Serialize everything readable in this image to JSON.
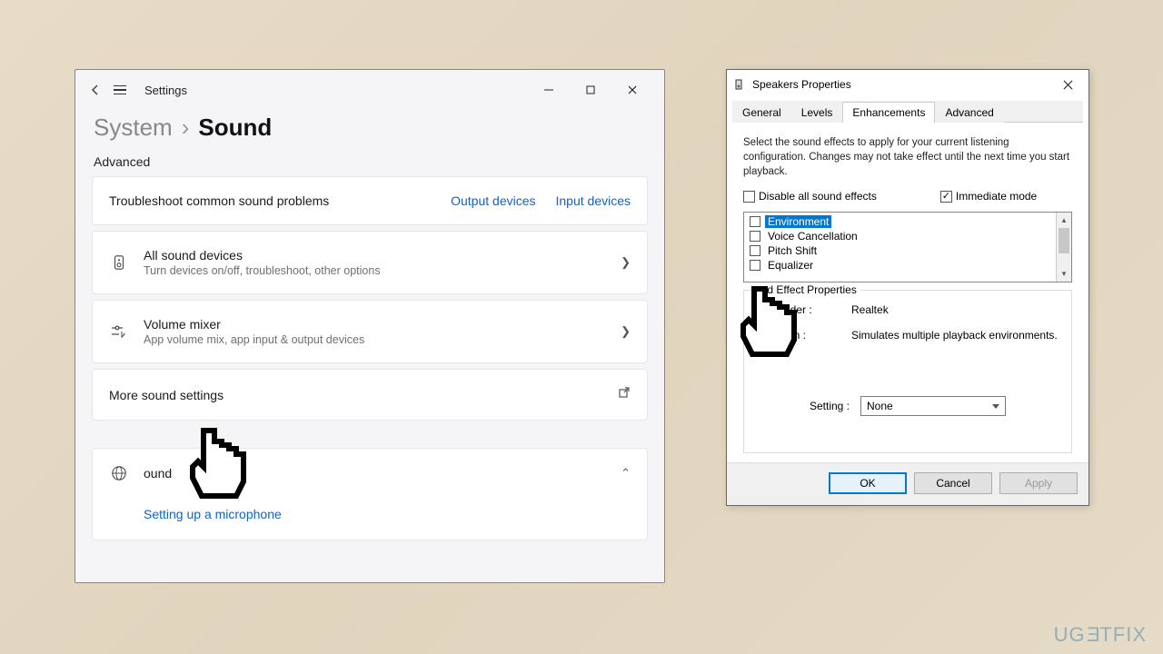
{
  "settings": {
    "title": "Settings",
    "breadcrumb": {
      "parent": "System",
      "sep": "›",
      "current": "Sound"
    },
    "section": "Advanced",
    "troubleshoot": {
      "title": "Troubleshoot common sound problems",
      "output_link": "Output devices",
      "input_link": "Input devices"
    },
    "all_devices": {
      "title": "All sound devices",
      "sub": "Turn devices on/off, troubleshoot, other options"
    },
    "mixer": {
      "title": "Volume mixer",
      "sub": "App volume mix, app input & output devices"
    },
    "more": {
      "title": "More sound settings"
    },
    "help": {
      "title": "ound",
      "link": "Setting up a microphone"
    }
  },
  "dialog": {
    "title": "Speakers Properties",
    "tabs": {
      "general": "General",
      "levels": "Levels",
      "enhancements": "Enhancements",
      "advanced": "Advanced"
    },
    "instruction": "Select the sound effects to apply for your current listening configuration. Changes may not take effect until the next time you start playback.",
    "disable_all": "Disable all sound effects",
    "immediate": "Immediate mode",
    "effects": [
      "Environment",
      "Voice Cancellation",
      "Pitch Shift",
      "Equalizer"
    ],
    "props": {
      "box_title": "und Effect Properties",
      "provider_label": "vider :",
      "provider_value": "Realtek",
      "desc_label": "tion :",
      "desc_value": "Simulates multiple playback environments."
    },
    "setting": {
      "label": "Setting :",
      "value": "None"
    },
    "buttons": {
      "ok": "OK",
      "cancel": "Cancel",
      "apply": "Apply"
    }
  },
  "watermark": "UGETFIX"
}
